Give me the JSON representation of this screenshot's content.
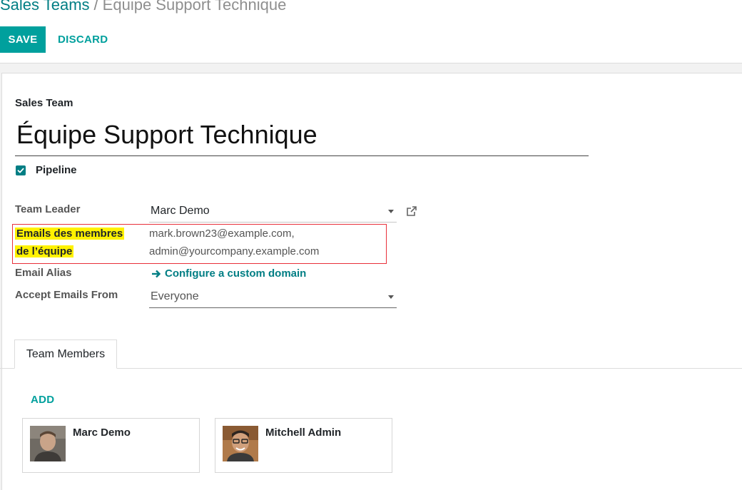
{
  "breadcrumb": {
    "parent": "Sales Teams",
    "separator": "/",
    "current": "Equipe Support Technique"
  },
  "toolbar": {
    "save_label": "SAVE",
    "discard_label": "DISCARD"
  },
  "form": {
    "name_caption": "Sales Team",
    "name_value": "Équipe Support Technique",
    "pipeline_label": "Pipeline",
    "pipeline_checked": true,
    "team_leader_label": "Team Leader",
    "team_leader_value": "Marc Demo",
    "emails_label_line1": "Emails des membres",
    "emails_label_line2": "de l’équipe",
    "emails_value_line1": "mark.brown23@example.com,",
    "emails_value_line2": "admin@yourcompany.example.com",
    "email_alias_label": "Email Alias",
    "email_alias_link": "Configure a custom domain",
    "accept_emails_label": "Accept Emails From",
    "accept_emails_value": "Everyone"
  },
  "tabs": [
    {
      "label": "Team Members",
      "active": true
    }
  ],
  "members": {
    "add_label": "ADD",
    "items": [
      {
        "name": "Marc Demo"
      },
      {
        "name": "Mitchell Admin"
      }
    ]
  },
  "colors": {
    "accent": "#00a09d",
    "link": "#017e84",
    "highlight": "#fff200",
    "annotation_border": "#e8303a"
  }
}
